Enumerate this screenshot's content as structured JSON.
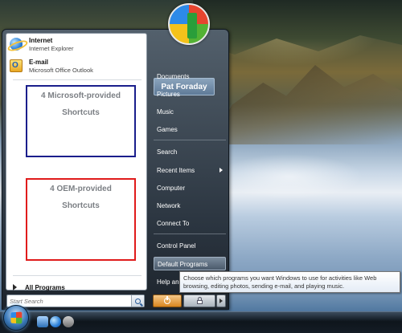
{
  "pinned": [
    {
      "title": "Internet",
      "subtitle": "Internet Explorer",
      "icon": "internet-explorer-icon"
    },
    {
      "title": "E-mail",
      "subtitle": "Microsoft Office Outlook",
      "icon": "outlook-icon"
    }
  ],
  "boxes": {
    "microsoft": {
      "line1": "4 Microsoft-provided",
      "line2": "Shortcuts",
      "color": "#1a1e8c"
    },
    "oem": {
      "line1": "4 OEM-provided",
      "line2": "Shortcuts",
      "color": "#e01b1b"
    }
  },
  "all_programs": "All Programs",
  "search_placeholder": "Start Search",
  "user_name": "Pat Foraday",
  "right_items": {
    "documents": "Documents",
    "pictures": "Pictures",
    "music": "Music",
    "games": "Games",
    "search": "Search",
    "recent_items": "Recent Items",
    "computer": "Computer",
    "network": "Network",
    "connect_to": "Connect To",
    "control_panel": "Control Panel",
    "default_programs": "Default Programs",
    "help": "Help and Support"
  },
  "tooltip": "Choose which programs you want Windows to use for activities like Web browsing, editing photos, sending e-mail, and playing music."
}
